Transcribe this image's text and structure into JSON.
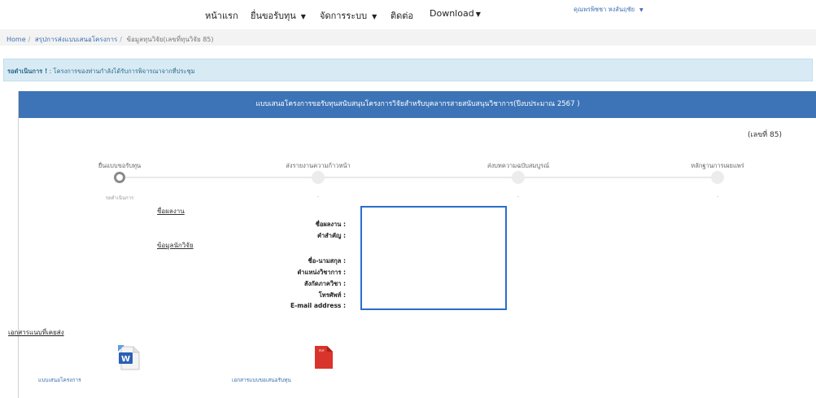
{
  "nav": {
    "home": "หน้าแรก",
    "apply": "ยื่นขอรับทุน",
    "manage": "จัดการระบบ",
    "contact": "ติดต่อ",
    "download": "Download",
    "user": "คุณพรพิชชา หงส์นฤชัย"
  },
  "breadcrumb": {
    "home": "Home",
    "summary": "สรุปการส่งแบบเสนอโครงการ",
    "current": "ข้อมูลทุนวิจัย(เลขที่ทุนวิจัย 85)"
  },
  "alert": {
    "strong": "รอดำเนินการ !",
    "text": ": โครงการของท่านกำลังได้รับการพิจารณาจากที่ประชุม"
  },
  "panel": {
    "title": "แบบเสนอโครงการขอรับทุนสนับสนุนโครงการวิจัยสำหรับบุคลากรสายสนับสนุนวิชาการ(ปีงบประมาณ 2567 )",
    "doc_number": "(เลขที่ 85)"
  },
  "steps": [
    {
      "label": "ยื่นแบบขอรับทุน",
      "sub": "รอดำเนินการ"
    },
    {
      "label": "ส่งรายงานความก้าวหน้า",
      "sub": "-"
    },
    {
      "label": "ส่งบทความฉบับสมบูรณ์",
      "sub": "-"
    },
    {
      "label": "หลักฐานการเผยแพร่",
      "sub": "-"
    }
  ],
  "work_section": {
    "title": "ชื่อผลงาน",
    "fields": [
      "ชื่อผลงาน :",
      "คำสำคัญ :"
    ]
  },
  "researcher_section": {
    "title": "ข้อมูลนักวิจัย",
    "fields": [
      "ชื่อ-นามสกุล :",
      "ตำแหน่งวิชาการ :",
      "สังกัดภาควิชา :",
      "โทรศัพท์ :",
      "E-mail address :"
    ]
  },
  "documents": {
    "title": "เอกสารแนบที่เคยส่ง",
    "items": [
      {
        "label": "แบบเสนอโครงการ",
        "icon": "word-doc-icon"
      },
      {
        "label": "เอกสารแบบขอเสนอรับทุน",
        "icon": "pdf-icon"
      }
    ]
  },
  "colors": {
    "header_blue": "#3d74b7",
    "link_blue": "#3c6fb0",
    "alert_bg": "#d8ebf5",
    "redact_border": "#2a6ec9",
    "pdf_red": "#d9342b"
  }
}
